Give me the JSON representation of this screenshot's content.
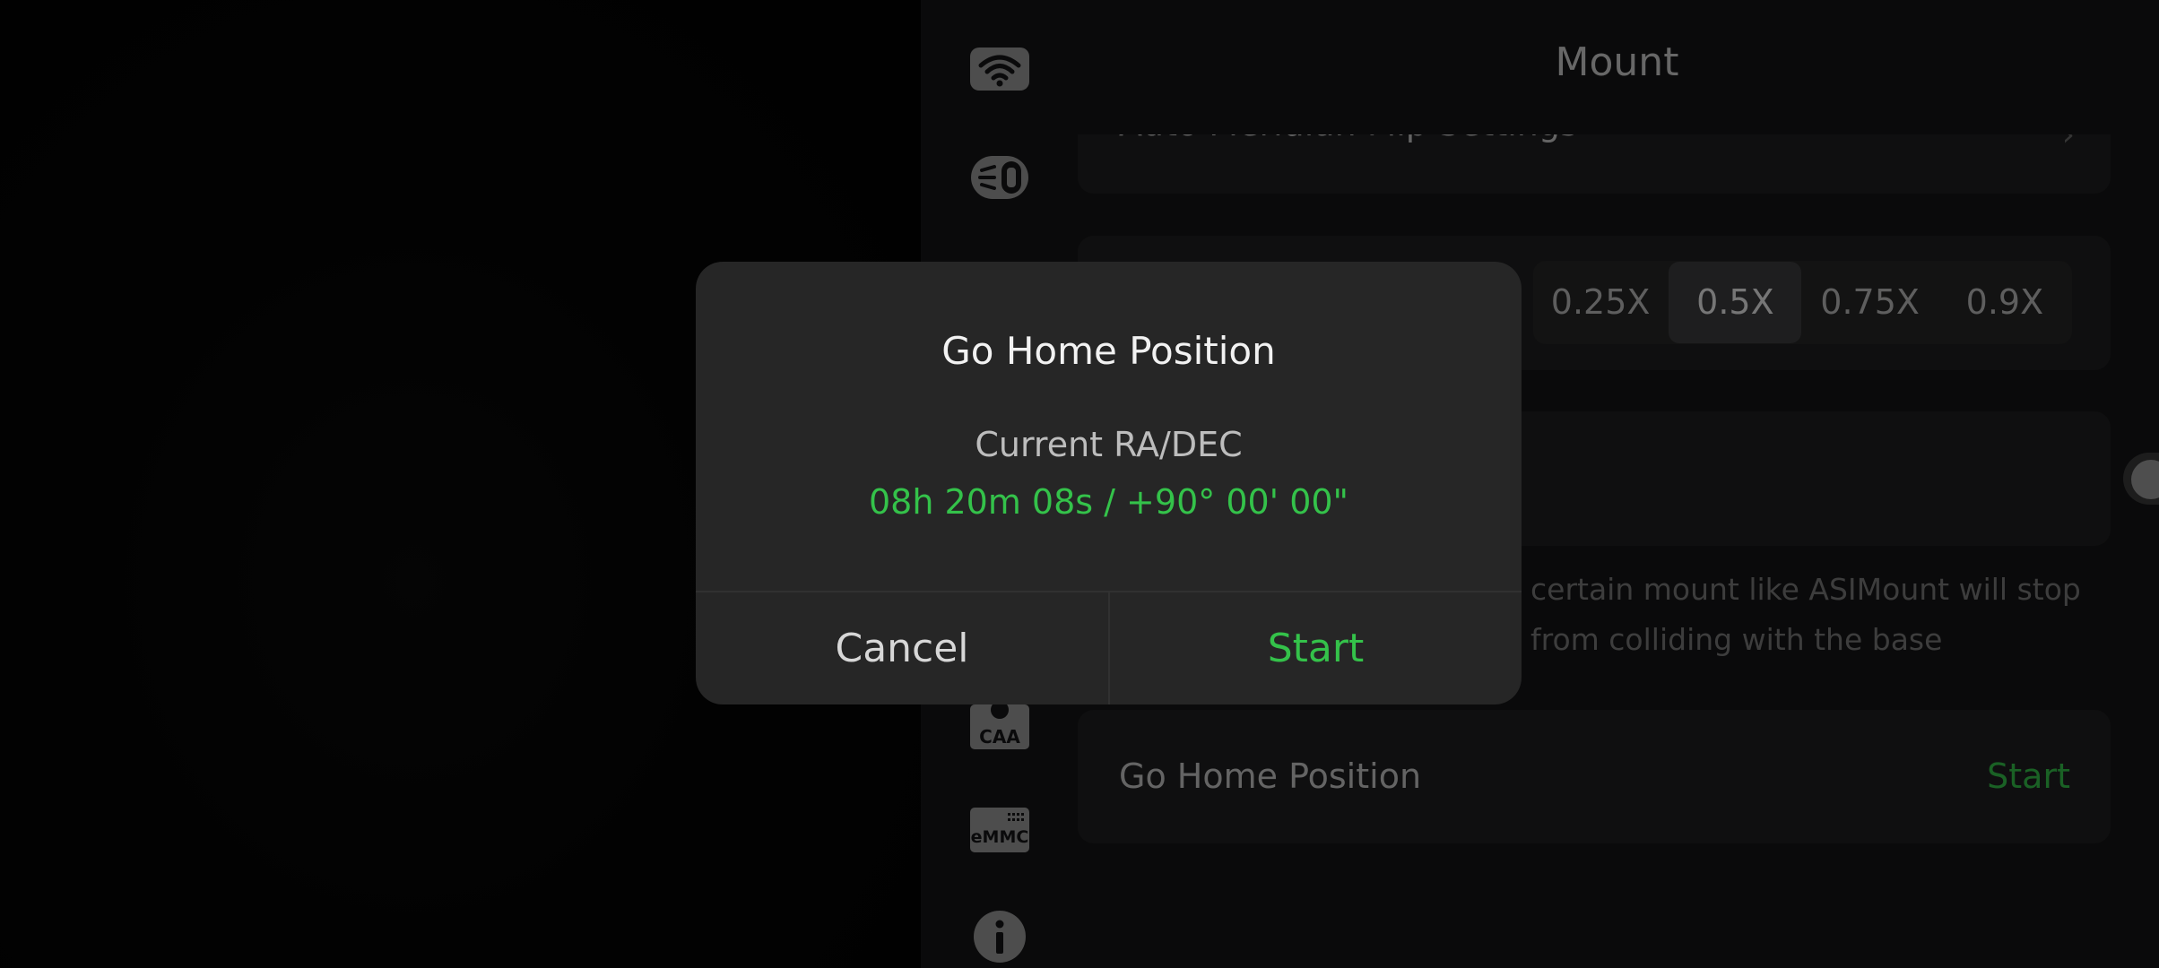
{
  "panel": {
    "title": "Mount",
    "cards": {
      "meridian_label": "Auto Meridian Flip Settings",
      "speed_options": [
        "0.25X",
        "0.5X",
        "0.75X",
        "0.9X"
      ],
      "speed_selected": "0.5X",
      "toggle_on": false,
      "note_line1": "certain mount like ASIMount will stop",
      "note_line2": "from colliding with the base",
      "go_home_label": "Go Home Position",
      "go_home_action": "Start"
    },
    "rail_labels": {
      "caa": "CAA",
      "emmc": "eMMC"
    },
    "rail_icons": [
      "wifi-icon",
      "focuser-icon",
      "half-circle-icon",
      "caa-icon",
      "emmc-icon",
      "info-icon"
    ]
  },
  "dialog": {
    "title": "Go Home Position",
    "subtitle": "Current RA/DEC",
    "value": "08h 20m 08s / +90° 00' 00\"",
    "cancel_label": "Cancel",
    "start_label": "Start"
  },
  "colors": {
    "accent_green": "#34c24a",
    "dialog_bg": "#262626",
    "panel_bg": "#151516"
  }
}
